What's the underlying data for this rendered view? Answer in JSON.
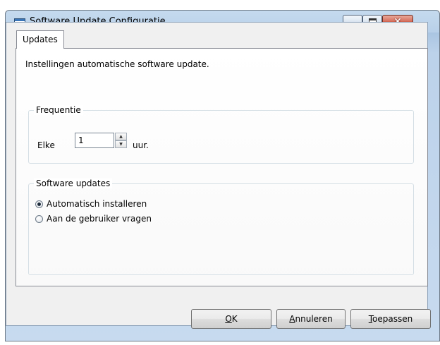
{
  "window": {
    "title": "Software Update Configuratie",
    "close_glyph": "✕"
  },
  "tabs": [
    {
      "label": "Updates",
      "selected": true
    }
  ],
  "intro_text": "Instellingen automatische software update.",
  "frequency": {
    "group_label": "Frequentie",
    "prefix_label": "Elke",
    "value": "1",
    "suffix_label": "uur.",
    "spin_up_glyph": "▲",
    "spin_down_glyph": "▼"
  },
  "updates": {
    "group_label": "Software updates",
    "options": [
      {
        "label": "Automatisch installeren",
        "checked": true
      },
      {
        "label": "Aan de gebruiker vragen",
        "checked": false
      }
    ]
  },
  "buttons": {
    "ok": {
      "mnemonic": "O",
      "rest": "K"
    },
    "cancel": {
      "mnemonic": "A",
      "rest": "nnuleren"
    },
    "apply": {
      "mnemonic": "T",
      "rest": "oepassen"
    }
  },
  "icons": {
    "app": "window-app-icon",
    "minimize": "minimize-icon",
    "maximize": "maximize-icon",
    "close": "close-icon"
  }
}
